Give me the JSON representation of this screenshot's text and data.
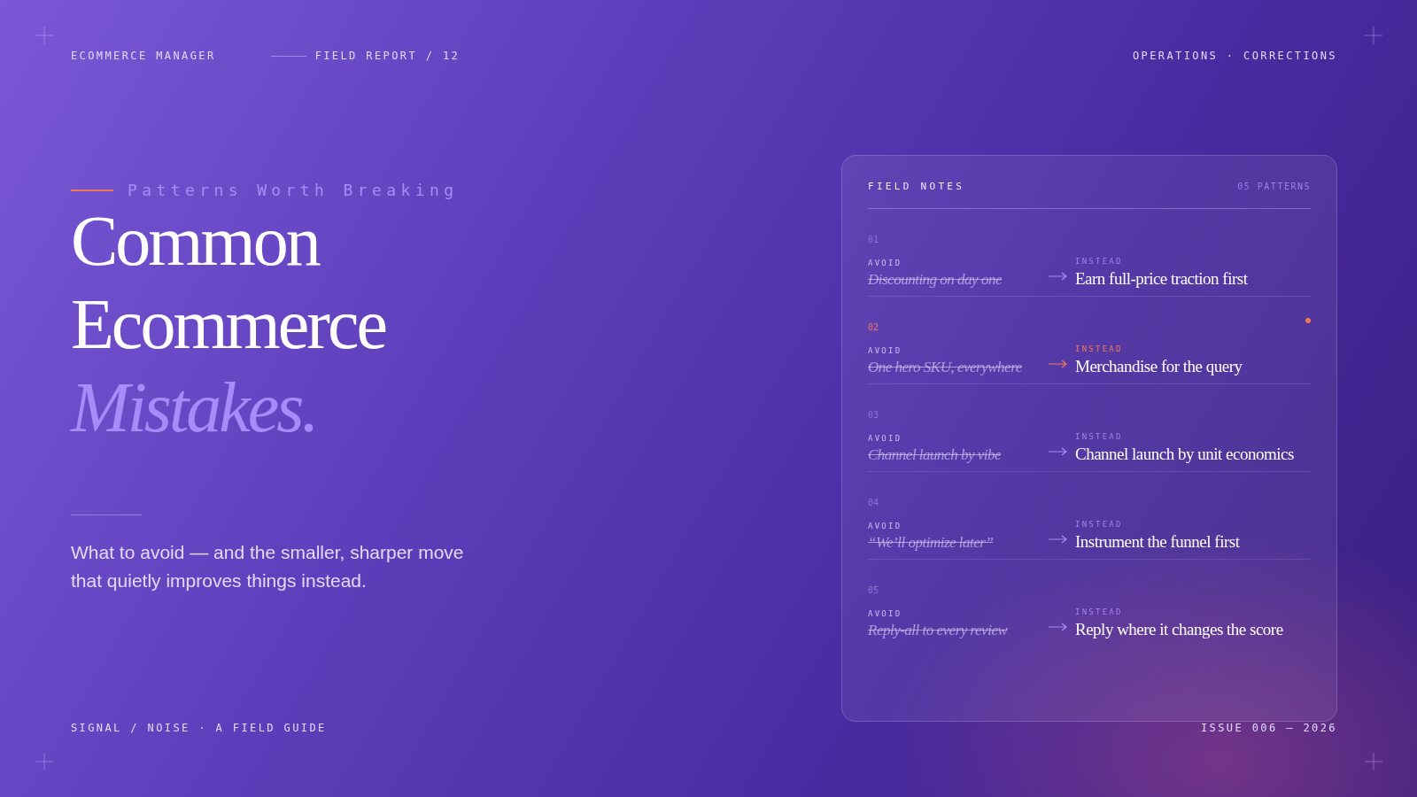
{
  "header": {
    "brand": "ECOMMERCE MANAGER",
    "report": "FIELD REPORT / 12",
    "section": "OPERATIONS · CORRECTIONS"
  },
  "hero": {
    "eyebrow": "Patterns Worth Breaking",
    "title_lines": [
      "Common",
      "Ecommerce"
    ],
    "title_accent": "Mistakes.",
    "lede": "What to avoid — and the smaller, sharper move that quietly improves things instead."
  },
  "field_notes": {
    "title": "FIELD NOTES",
    "count": "05 PATTERNS",
    "rows": [
      {
        "number": "01",
        "avoid_label": "AVOID",
        "avoid": "Discounting on day one",
        "instead_label": "INSTEAD",
        "instead": "Earn full-price traction first",
        "selected": false
      },
      {
        "number": "02",
        "avoid_label": "AVOID",
        "avoid": "One hero SKU, everywhere",
        "instead_label": "INSTEAD",
        "instead": "Merchandise for the query",
        "selected": true
      },
      {
        "number": "03",
        "avoid_label": "AVOID",
        "avoid": "Channel launch by vibe",
        "instead_label": "INSTEAD",
        "instead": "Channel launch by unit economics",
        "selected": false
      },
      {
        "number": "04",
        "avoid_label": "AVOID",
        "avoid": "“We’ll optimize later”",
        "instead_label": "INSTEAD",
        "instead": "Instrument the funnel first",
        "selected": false
      },
      {
        "number": "05",
        "avoid_label": "AVOID",
        "avoid": "Reply-all to every review",
        "instead_label": "INSTEAD",
        "instead": "Reply where it changes the score",
        "selected": false
      }
    ]
  },
  "footer": {
    "left": "SIGNAL / NOISE · A FIELD GUIDE",
    "right": "ISSUE 006 — 2026"
  }
}
